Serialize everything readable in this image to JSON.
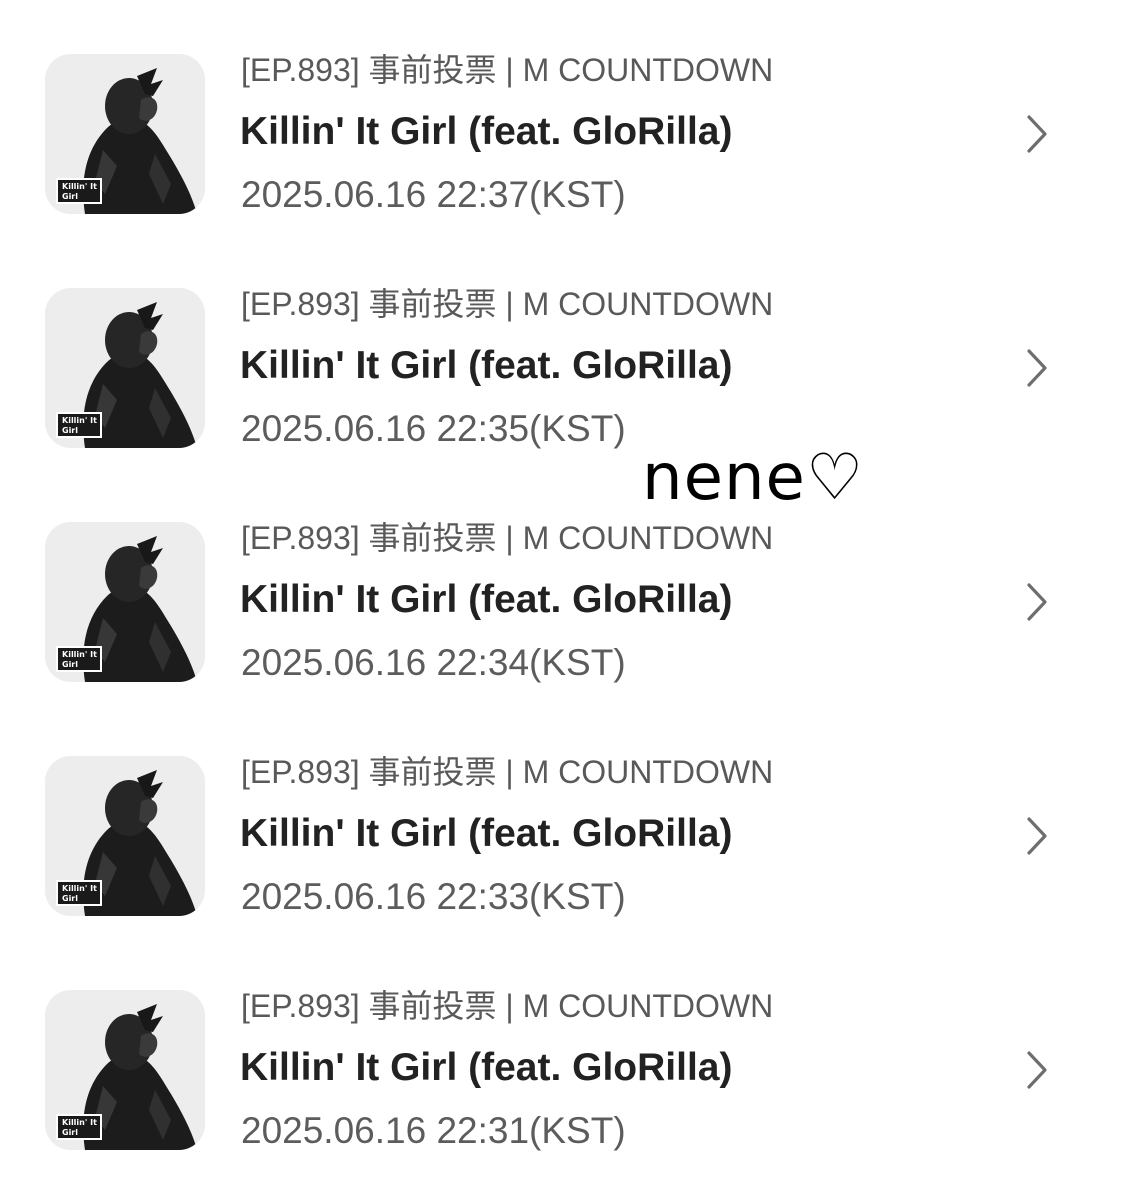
{
  "list": {
    "items": [
      {
        "ep_label": "[EP.893] 事前投票 | M COUNTDOWN",
        "title": "Killin' It Girl (feat. GloRilla)",
        "time": "2025.06.16 22:37(KST)",
        "thumb_text": "Killin' It\nGirl"
      },
      {
        "ep_label": "[EP.893] 事前投票 | M COUNTDOWN",
        "title": "Killin' It Girl (feat. GloRilla)",
        "time": "2025.06.16 22:35(KST)",
        "thumb_text": "Killin' It\nGirl"
      },
      {
        "ep_label": "[EP.893] 事前投票 | M COUNTDOWN",
        "title": "Killin' It Girl (feat. GloRilla)",
        "time": "2025.06.16 22:34(KST)",
        "thumb_text": "Killin' It\nGirl"
      },
      {
        "ep_label": "[EP.893] 事前投票 | M COUNTDOWN",
        "title": "Killin' It Girl (feat. GloRilla)",
        "time": "2025.06.16 22:33(KST)",
        "thumb_text": "Killin' It\nGirl"
      },
      {
        "ep_label": "[EP.893] 事前投票 | M COUNTDOWN",
        "title": "Killin' It Girl (feat. GloRilla)",
        "time": "2025.06.16 22:31(KST)",
        "thumb_text": "Killin' It\nGirl"
      }
    ]
  },
  "overlay": {
    "handwriting": "nene♡"
  },
  "icons": {
    "row_chevron": "chevron-right-icon",
    "thumbnail": "album-cover-image"
  },
  "colors": {
    "background": "#ffffff",
    "title_text": "#222222",
    "meta_text": "#5c5c5c",
    "chevron": "#6e6e6e"
  }
}
